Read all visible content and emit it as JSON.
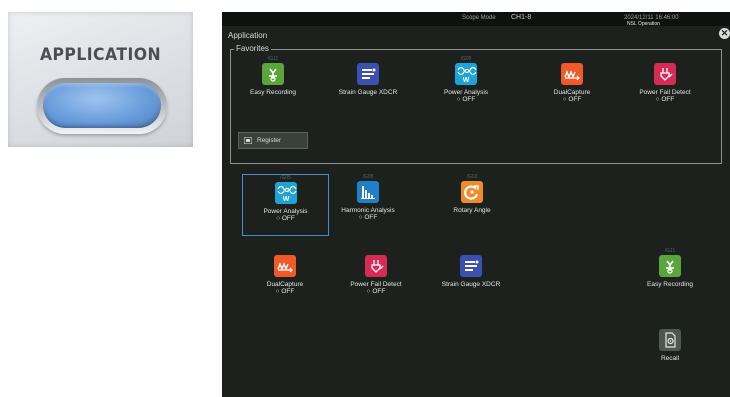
{
  "key": {
    "label": "APPLICATION"
  },
  "screen": {
    "status_bar": {
      "scope": "Scope Mode",
      "channel": "CH1-8",
      "date": "2024/12/11 16:46:00",
      "sub": "NSL Operation"
    },
    "title": "Application",
    "close_label": "✕",
    "favorites": {
      "title": "Favorites",
      "register_label": "Register",
      "items": [
        {
          "version": "/G11",
          "name": "Easy Recording",
          "status": "",
          "color": "#5aa63d",
          "icon": "easy-recording-icon"
        },
        {
          "version": "",
          "name": "Strain Gauge XDCR",
          "status": "",
          "color": "#3d4fb0",
          "icon": "strain-gauge-icon"
        },
        {
          "version": "/G05",
          "name": "Power Analysis",
          "status": "○ OFF",
          "color": "#1ea3d8",
          "icon": "power-analysis-icon"
        },
        {
          "version": "",
          "name": "DualCapture",
          "status": "○ OFF",
          "color": "#ef5a2a",
          "icon": "dualcapture-icon"
        },
        {
          "version": "",
          "name": "Power Fail Detect",
          "status": "○ OFF",
          "color": "#d62b57",
          "icon": "power-fail-detect-icon"
        }
      ]
    },
    "apps": [
      {
        "version": "/G05",
        "name": "Power Analysis",
        "status": "○ OFF",
        "color": "#1ea3d8",
        "icon": "power-analysis-icon",
        "selected": true
      },
      {
        "version": "/G05",
        "name": "Harmonic Analysis",
        "status": "○ OFF",
        "color": "#1f7fc7",
        "icon": "harmonic-analysis-icon",
        "selected": false
      },
      {
        "version": "/G03",
        "name": "Rotary Angle",
        "status": "",
        "color": "#f08a2a",
        "icon": "rotary-angle-icon",
        "selected": false
      },
      {
        "version": "",
        "name": "DualCapture",
        "status": "○ OFF",
        "color": "#ef5a2a",
        "icon": "dualcapture-icon",
        "selected": false
      },
      {
        "version": "",
        "name": "Power Fail Detect",
        "status": "○ OFF",
        "color": "#d62b57",
        "icon": "power-fail-detect-icon",
        "selected": false
      },
      {
        "version": "",
        "name": "Strain Gauge XDCR",
        "status": "",
        "color": "#3d4fb0",
        "icon": "strain-gauge-icon",
        "selected": false
      },
      {
        "version": "/G11",
        "name": "Easy Recording",
        "status": "",
        "color": "#5aa63d",
        "icon": "easy-recording-icon",
        "selected": false
      },
      {
        "version": "",
        "name": "Recall",
        "status": "",
        "color": "#4f5753",
        "icon": "recall-icon",
        "selected": false
      }
    ]
  }
}
